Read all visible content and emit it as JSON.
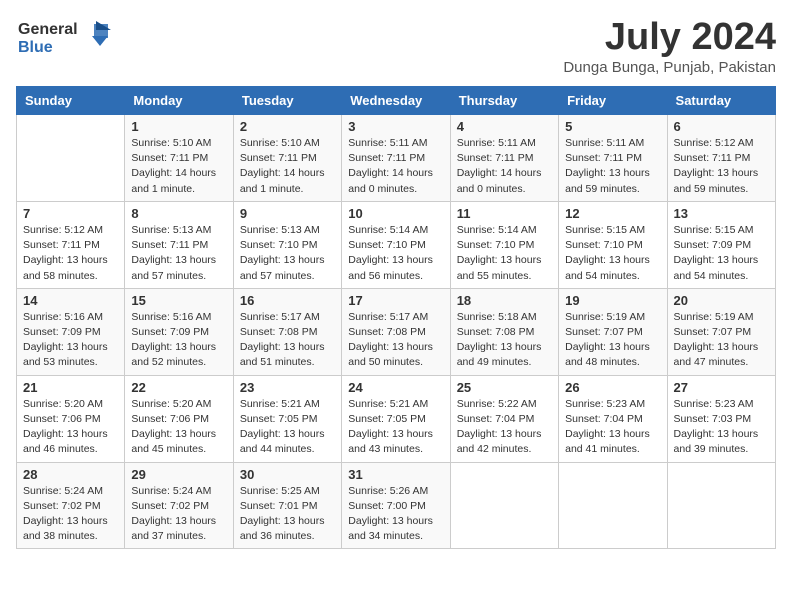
{
  "header": {
    "logo_line1": "General",
    "logo_line2": "Blue",
    "month_title": "July 2024",
    "location": "Dunga Bunga, Punjab, Pakistan"
  },
  "days_of_week": [
    "Sunday",
    "Monday",
    "Tuesday",
    "Wednesday",
    "Thursday",
    "Friday",
    "Saturday"
  ],
  "weeks": [
    [
      {
        "day": "",
        "info": ""
      },
      {
        "day": "1",
        "info": "Sunrise: 5:10 AM\nSunset: 7:11 PM\nDaylight: 14 hours\nand 1 minute."
      },
      {
        "day": "2",
        "info": "Sunrise: 5:10 AM\nSunset: 7:11 PM\nDaylight: 14 hours\nand 1 minute."
      },
      {
        "day": "3",
        "info": "Sunrise: 5:11 AM\nSunset: 7:11 PM\nDaylight: 14 hours\nand 0 minutes."
      },
      {
        "day": "4",
        "info": "Sunrise: 5:11 AM\nSunset: 7:11 PM\nDaylight: 14 hours\nand 0 minutes."
      },
      {
        "day": "5",
        "info": "Sunrise: 5:11 AM\nSunset: 7:11 PM\nDaylight: 13 hours\nand 59 minutes."
      },
      {
        "day": "6",
        "info": "Sunrise: 5:12 AM\nSunset: 7:11 PM\nDaylight: 13 hours\nand 59 minutes."
      }
    ],
    [
      {
        "day": "7",
        "info": "Sunrise: 5:12 AM\nSunset: 7:11 PM\nDaylight: 13 hours\nand 58 minutes."
      },
      {
        "day": "8",
        "info": "Sunrise: 5:13 AM\nSunset: 7:11 PM\nDaylight: 13 hours\nand 57 minutes."
      },
      {
        "day": "9",
        "info": "Sunrise: 5:13 AM\nSunset: 7:10 PM\nDaylight: 13 hours\nand 57 minutes."
      },
      {
        "day": "10",
        "info": "Sunrise: 5:14 AM\nSunset: 7:10 PM\nDaylight: 13 hours\nand 56 minutes."
      },
      {
        "day": "11",
        "info": "Sunrise: 5:14 AM\nSunset: 7:10 PM\nDaylight: 13 hours\nand 55 minutes."
      },
      {
        "day": "12",
        "info": "Sunrise: 5:15 AM\nSunset: 7:10 PM\nDaylight: 13 hours\nand 54 minutes."
      },
      {
        "day": "13",
        "info": "Sunrise: 5:15 AM\nSunset: 7:09 PM\nDaylight: 13 hours\nand 54 minutes."
      }
    ],
    [
      {
        "day": "14",
        "info": "Sunrise: 5:16 AM\nSunset: 7:09 PM\nDaylight: 13 hours\nand 53 minutes."
      },
      {
        "day": "15",
        "info": "Sunrise: 5:16 AM\nSunset: 7:09 PM\nDaylight: 13 hours\nand 52 minutes."
      },
      {
        "day": "16",
        "info": "Sunrise: 5:17 AM\nSunset: 7:08 PM\nDaylight: 13 hours\nand 51 minutes."
      },
      {
        "day": "17",
        "info": "Sunrise: 5:17 AM\nSunset: 7:08 PM\nDaylight: 13 hours\nand 50 minutes."
      },
      {
        "day": "18",
        "info": "Sunrise: 5:18 AM\nSunset: 7:08 PM\nDaylight: 13 hours\nand 49 minutes."
      },
      {
        "day": "19",
        "info": "Sunrise: 5:19 AM\nSunset: 7:07 PM\nDaylight: 13 hours\nand 48 minutes."
      },
      {
        "day": "20",
        "info": "Sunrise: 5:19 AM\nSunset: 7:07 PM\nDaylight: 13 hours\nand 47 minutes."
      }
    ],
    [
      {
        "day": "21",
        "info": "Sunrise: 5:20 AM\nSunset: 7:06 PM\nDaylight: 13 hours\nand 46 minutes."
      },
      {
        "day": "22",
        "info": "Sunrise: 5:20 AM\nSunset: 7:06 PM\nDaylight: 13 hours\nand 45 minutes."
      },
      {
        "day": "23",
        "info": "Sunrise: 5:21 AM\nSunset: 7:05 PM\nDaylight: 13 hours\nand 44 minutes."
      },
      {
        "day": "24",
        "info": "Sunrise: 5:21 AM\nSunset: 7:05 PM\nDaylight: 13 hours\nand 43 minutes."
      },
      {
        "day": "25",
        "info": "Sunrise: 5:22 AM\nSunset: 7:04 PM\nDaylight: 13 hours\nand 42 minutes."
      },
      {
        "day": "26",
        "info": "Sunrise: 5:23 AM\nSunset: 7:04 PM\nDaylight: 13 hours\nand 41 minutes."
      },
      {
        "day": "27",
        "info": "Sunrise: 5:23 AM\nSunset: 7:03 PM\nDaylight: 13 hours\nand 39 minutes."
      }
    ],
    [
      {
        "day": "28",
        "info": "Sunrise: 5:24 AM\nSunset: 7:02 PM\nDaylight: 13 hours\nand 38 minutes."
      },
      {
        "day": "29",
        "info": "Sunrise: 5:24 AM\nSunset: 7:02 PM\nDaylight: 13 hours\nand 37 minutes."
      },
      {
        "day": "30",
        "info": "Sunrise: 5:25 AM\nSunset: 7:01 PM\nDaylight: 13 hours\nand 36 minutes."
      },
      {
        "day": "31",
        "info": "Sunrise: 5:26 AM\nSunset: 7:00 PM\nDaylight: 13 hours\nand 34 minutes."
      },
      {
        "day": "",
        "info": ""
      },
      {
        "day": "",
        "info": ""
      },
      {
        "day": "",
        "info": ""
      }
    ]
  ]
}
